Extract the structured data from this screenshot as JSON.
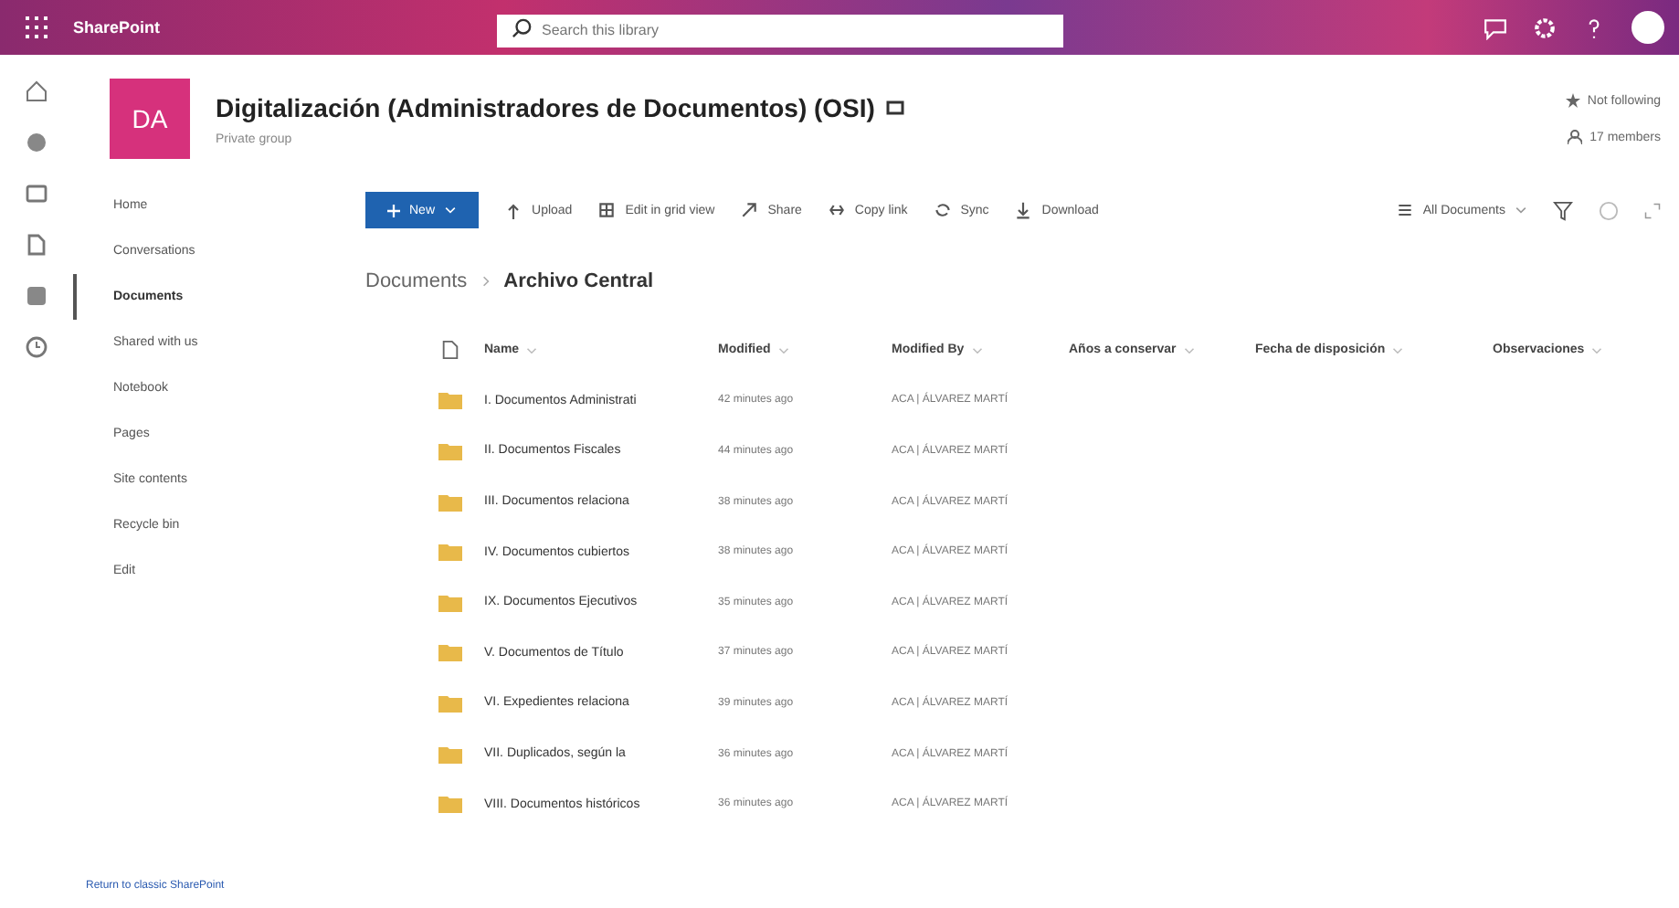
{
  "suite_bar": {
    "app_name": "SharePoint",
    "search": {
      "placeholder": "Search this library"
    }
  },
  "site": {
    "logo": "DA",
    "title": "Digitalización (Administradores de Documentos) (OSI)",
    "subtitle": "Private group",
    "follow": "Not following",
    "members": "17 members"
  },
  "nav": {
    "items": [
      {
        "label": "Home",
        "selected": false
      },
      {
        "label": "Conversations",
        "selected": false
      },
      {
        "label": "Documents",
        "selected": true
      },
      {
        "label": "Shared with us",
        "selected": false
      },
      {
        "label": "Notebook",
        "selected": false
      },
      {
        "label": "Pages",
        "selected": false
      },
      {
        "label": "Site contents",
        "selected": false
      },
      {
        "label": "Recycle bin",
        "selected": false
      },
      {
        "label": "Edit",
        "selected": false
      }
    ],
    "footer_link": "Return to classic SharePoint"
  },
  "command_bar": {
    "new": "New",
    "items": [
      {
        "kind": "upload",
        "label": "Upload"
      },
      {
        "kind": "grid",
        "label": "Edit in grid view"
      },
      {
        "kind": "share",
        "label": "Share"
      },
      {
        "kind": "link",
        "label": "Copy link"
      },
      {
        "kind": "sync",
        "label": "Sync"
      },
      {
        "kind": "download",
        "label": "Download"
      }
    ],
    "view": "All Documents"
  },
  "breadcrumb": [
    "Documents",
    "Archivo Central"
  ],
  "table": {
    "columns": [
      "Name",
      "Modified",
      "Modified By",
      "Años a conservar",
      "Fecha de disposición",
      "Observaciones"
    ],
    "rows": [
      {
        "name": "I. Documentos Administrati",
        "modified": "42 minutes ago",
        "modified_by": "ACA | ÁLVAREZ MARTÍ"
      },
      {
        "name": "II. Documentos Fiscales",
        "modified": "44 minutes ago",
        "modified_by": "ACA | ÁLVAREZ MARTÍ"
      },
      {
        "name": "III. Documentos relaciona",
        "modified": "38 minutes ago",
        "modified_by": "ACA | ÁLVAREZ MARTÍ"
      },
      {
        "name": "IV. Documentos cubiertos",
        "modified": "38 minutes ago",
        "modified_by": "ACA | ÁLVAREZ MARTÍ"
      },
      {
        "name": "IX. Documentos Ejecutivos",
        "modified": "35 minutes ago",
        "modified_by": "ACA | ÁLVAREZ MARTÍ"
      },
      {
        "name": "V. Documentos de Título",
        "modified": "37 minutes ago",
        "modified_by": "ACA | ÁLVAREZ MARTÍ"
      },
      {
        "name": "VI. Expedientes relaciona",
        "modified": "39 minutes ago",
        "modified_by": "ACA | ÁLVAREZ MARTÍ"
      },
      {
        "name": "VII. Duplicados, según la",
        "modified": "36 minutes ago",
        "modified_by": "ACA | ÁLVAREZ MARTÍ"
      },
      {
        "name": "VIII. Documentos históricos",
        "modified": "36 minutes ago",
        "modified_by": "ACA | ÁLVAREZ MARTÍ"
      }
    ]
  }
}
